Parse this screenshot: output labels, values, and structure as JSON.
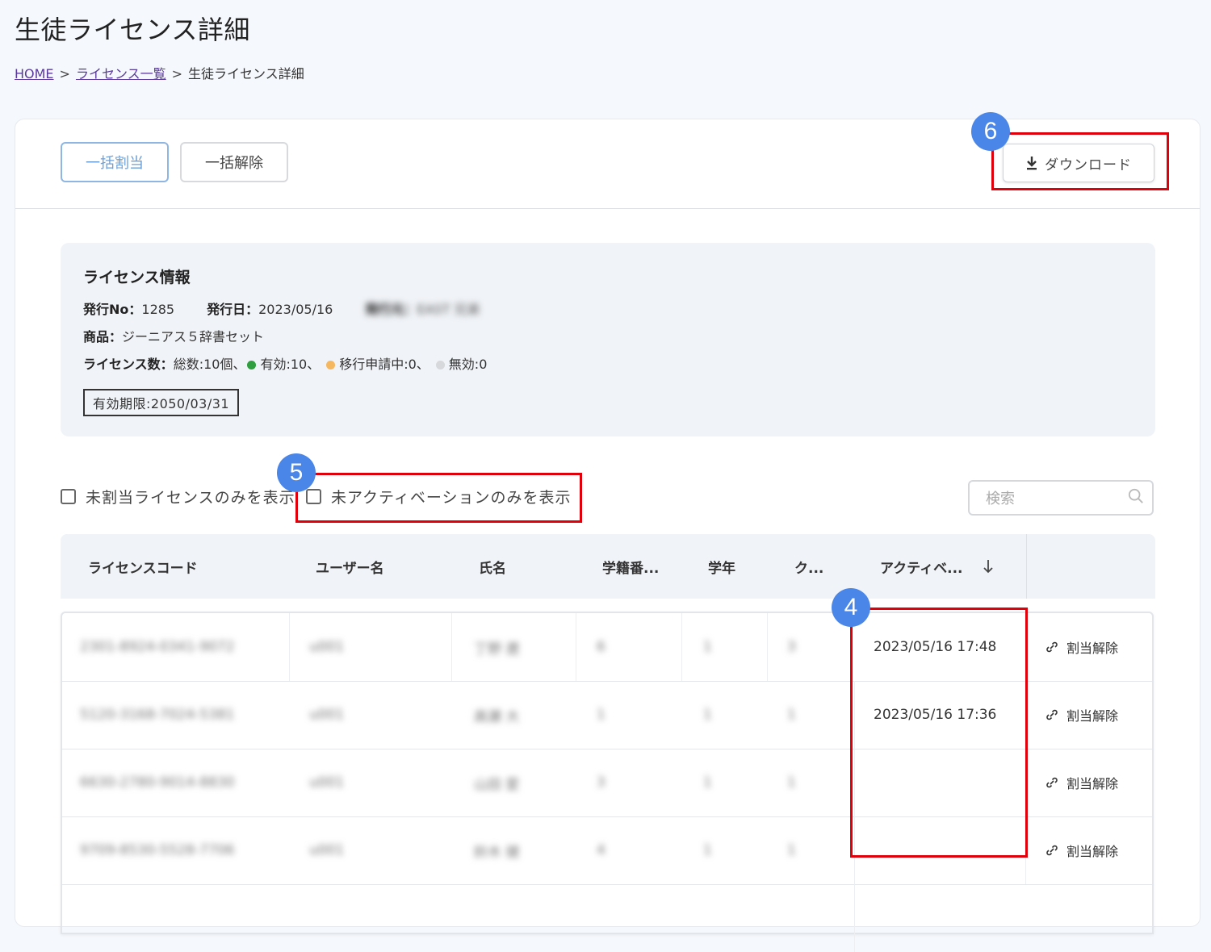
{
  "page": {
    "title": "生徒ライセンス詳細"
  },
  "breadcrumb": {
    "home": "HOME",
    "list": "ライセンス一覧",
    "current": "生徒ライセンス詳細",
    "separator": ">"
  },
  "toolbar": {
    "assign_all": "一括割当",
    "release_all": "一括解除",
    "download": "ダウンロード"
  },
  "badges": {
    "download": "6",
    "filter": "5",
    "activation_column": "4"
  },
  "license_info": {
    "title": "ライセンス情報",
    "issue_no_label": "発行No：",
    "issue_no": "1285",
    "issue_date_label": "発行日：",
    "issue_date": "2023/05/16",
    "issuer_label": "発行元：",
    "issuer": "EAST 兄弟",
    "product_label": "商品：",
    "product": "ジーニアス５辞書セット",
    "count_label": "ライセンス数：",
    "total": "総数:10個、",
    "active": "有効:10、",
    "pending": "移行申請中:0、",
    "invalid": "無効:0",
    "expiry": "有効期限:2050/03/31",
    "colors": {
      "active": "#2e9e3e",
      "pending": "#f5b860",
      "invalid": "#d6d8db"
    }
  },
  "filters": {
    "unassigned_only": "未割当ライセンスのみを表示",
    "unactivated_only": "未アクティベーションのみを表示",
    "search_placeholder": "検索"
  },
  "table": {
    "headers": {
      "code": "ライセンスコード",
      "user": "ユーザー名",
      "name": "氏名",
      "student_no": "学籍番...",
      "grade": "学年",
      "class": "ク...",
      "activation": "アクティベ..."
    },
    "rows": [
      {
        "code": "2301-8924-0341-9072",
        "user": "u001",
        "name": "丁野 遼",
        "student_no": "6",
        "grade": "1",
        "class": "3",
        "activation": "2023/05/16 17:48",
        "action": "割当解除"
      },
      {
        "code": "5120-3168-7024-5381",
        "user": "u001",
        "name": "高瀬 大",
        "student_no": "1",
        "grade": "1",
        "class": "1",
        "activation": "2023/05/16 17:36",
        "action": "割当解除"
      },
      {
        "code": "6630-2780-9014-8830",
        "user": "u001",
        "name": "山田 愛",
        "student_no": "3",
        "grade": "1",
        "class": "1",
        "activation": "",
        "action": "割当解除"
      },
      {
        "code": "9709-8530-5528-7706",
        "user": "u001",
        "name": "鈴木 健",
        "student_no": "4",
        "grade": "1",
        "class": "1",
        "activation": "",
        "action": "割当解除"
      }
    ]
  }
}
